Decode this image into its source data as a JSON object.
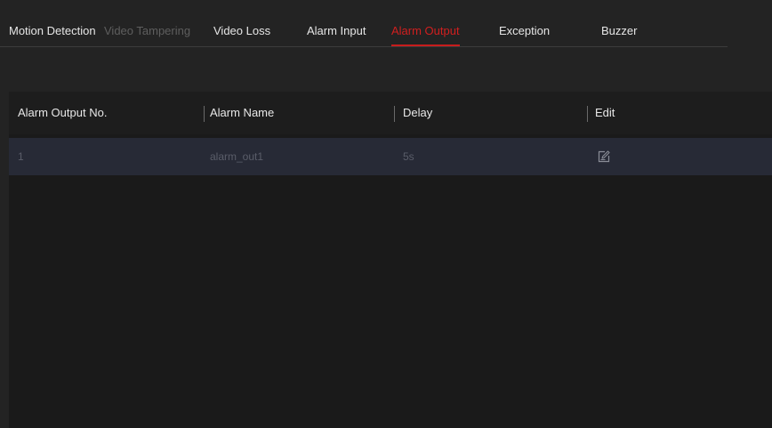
{
  "tabs": [
    {
      "label": "Motion Detection",
      "state": "normal"
    },
    {
      "label": "Video Tampering",
      "state": "disabled"
    },
    {
      "label": "Video Loss",
      "state": "normal"
    },
    {
      "label": "Alarm Input",
      "state": "normal"
    },
    {
      "label": "Alarm Output",
      "state": "active"
    },
    {
      "label": "Exception",
      "state": "normal"
    },
    {
      "label": "Buzzer",
      "state": "normal"
    }
  ],
  "table": {
    "columns": [
      "Alarm Output No.",
      "Alarm Name",
      "Delay",
      "Edit"
    ],
    "rows": [
      {
        "no": "1",
        "name": "alarm_out1",
        "delay": "5s",
        "edit_icon": "edit-icon"
      }
    ]
  },
  "colors": {
    "background": "#232323",
    "active_tab": "#d11f1f",
    "disabled_tab": "#5e5e5e",
    "row_background": "#272a36"
  }
}
